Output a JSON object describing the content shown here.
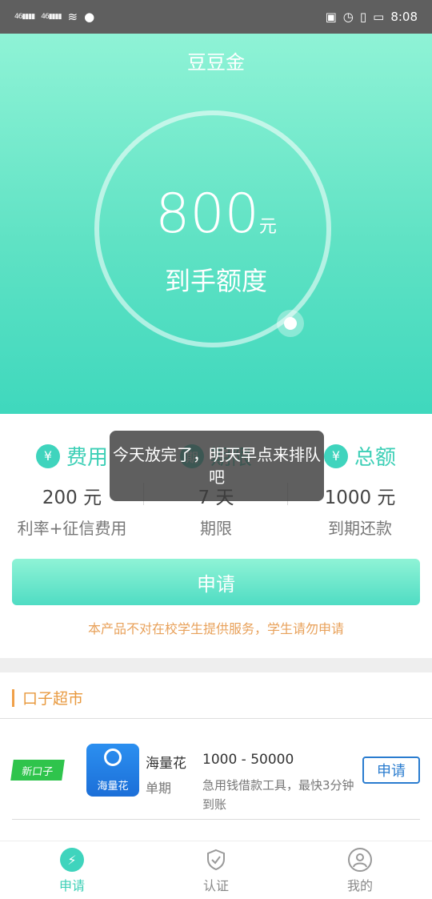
{
  "status_bar": {
    "signal_1": "46",
    "signal_2": "46",
    "time": "8:08"
  },
  "hero": {
    "title": "豆豆金",
    "amount": "800",
    "unit": "元",
    "label": "到手额度"
  },
  "stats": [
    {
      "icon": "¥",
      "title": "费用",
      "value": "200 元",
      "sub": "利率+征信费用"
    },
    {
      "icon": "期",
      "title": "期限",
      "value": "7 天",
      "sub": "期限"
    },
    {
      "icon": "¥",
      "title": "总额",
      "value": "1000 元",
      "sub": "到期还款"
    }
  ],
  "toast": "今天放完了，明天早点来排队吧",
  "apply_button": "申请",
  "notice": "本产品不对在校学生提供服务，学生请勿申请",
  "market": {
    "title": "口子超市",
    "items": [
      {
        "tag": "新口子",
        "icon_text": "海量花",
        "name": "海量花",
        "term": "单期",
        "range": "1000 - 50000",
        "desc": "急用钱借款工具，最快3分钟到账",
        "apply": "申请"
      }
    ]
  },
  "nav": [
    {
      "label": "申请",
      "icon": "lightning-icon",
      "active": true
    },
    {
      "label": "认证",
      "icon": "shield-check-icon",
      "active": false
    },
    {
      "label": "我的",
      "icon": "user-icon",
      "active": false
    }
  ],
  "colors": {
    "accent": "#3fd4bd",
    "notice": "#e8a15a",
    "section": "#e8993e",
    "link_blue": "#2a7ccf"
  }
}
